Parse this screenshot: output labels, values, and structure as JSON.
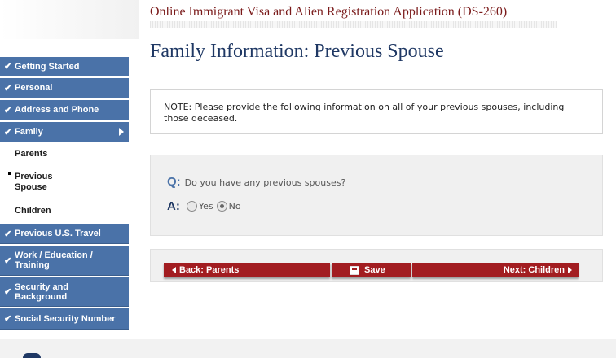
{
  "app_title": "Online Immigrant Visa and Alien Registration Application (DS-260)",
  "page_title": "Family Information: Previous Spouse",
  "sidebar": {
    "items": [
      {
        "label": "Getting Started"
      },
      {
        "label": "Personal"
      },
      {
        "label": "Address and Phone"
      },
      {
        "label": "Family"
      },
      {
        "label": "Previous U.S. Travel"
      },
      {
        "label": "Work / Education / Training"
      },
      {
        "label": "Security and Background"
      },
      {
        "label": "Social Security Number"
      }
    ],
    "sub_items": [
      {
        "label": "Parents"
      },
      {
        "label": "Previous Spouse"
      },
      {
        "label": "Children"
      }
    ]
  },
  "note": "NOTE: Please provide the following information on all of your previous spouses, including those deceased.",
  "question": {
    "q_letter": "Q:",
    "text": "Do you have any previous spouses?",
    "a_letter": "A:",
    "options": [
      {
        "label": "Yes",
        "checked": false
      },
      {
        "label": "No",
        "checked": true
      }
    ]
  },
  "buttons": {
    "back": "Back: Parents",
    "save": "Save",
    "next": "Next: Children"
  },
  "colors": {
    "nav_blue": "#4a72a8",
    "button_red": "#a21d21",
    "title_maroon": "#7a1a1a",
    "heading_navy": "#1f3864"
  }
}
